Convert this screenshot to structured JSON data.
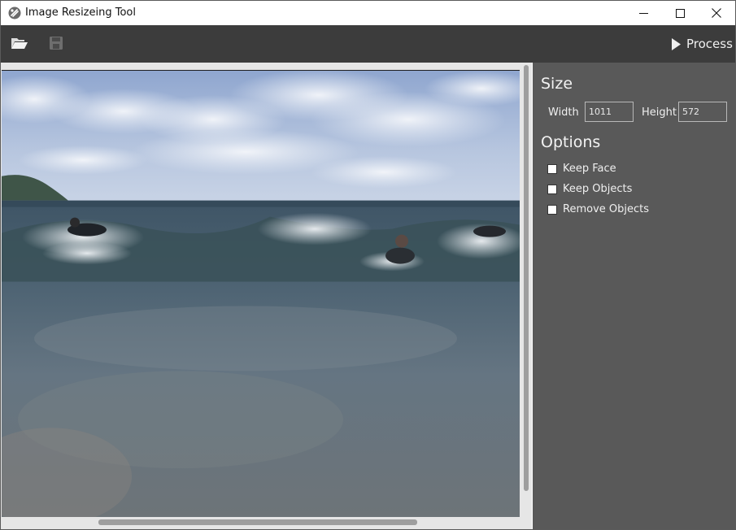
{
  "window": {
    "title": "Image Resizeing Tool"
  },
  "toolbar": {
    "process_label": "Process"
  },
  "size": {
    "title": "Size",
    "width_label": "Width",
    "width_value": "1011",
    "height_label": "Height",
    "height_value": "572"
  },
  "options": {
    "title": "Options",
    "items": [
      {
        "label": "Keep Face",
        "checked": false
      },
      {
        "label": "Keep Objects",
        "checked": false
      },
      {
        "label": "Remove Objects",
        "checked": false
      }
    ]
  },
  "colors": {
    "toolbar_bg": "#3c3c3c",
    "side_panel_bg": "#595959",
    "image_panel_bg": "#e6e6e6"
  },
  "icons": [
    "app-icon",
    "minimize-icon",
    "maximize-icon",
    "close-icon",
    "folder-open-icon",
    "save-icon",
    "play-icon"
  ]
}
